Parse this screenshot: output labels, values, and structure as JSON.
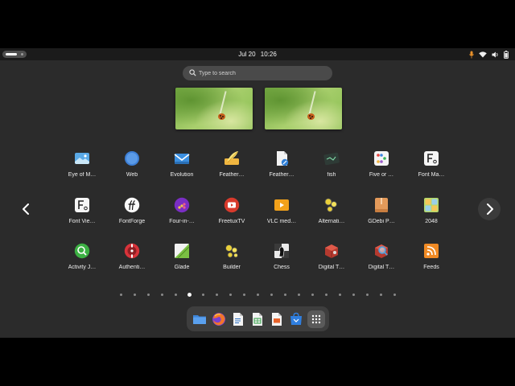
{
  "topbar": {
    "date": "Jul 20",
    "time": "10:26",
    "tray_icons": [
      "microphone-icon",
      "wifi-icon",
      "volume-icon",
      "battery-icon"
    ],
    "mic_color": "#e8902a"
  },
  "search": {
    "placeholder": "Type to search"
  },
  "workspaces": [
    {
      "name": "workspace-1"
    },
    {
      "name": "workspace-2"
    }
  ],
  "apps": [
    {
      "label": "Eye of M…",
      "icon": "eye-of-gnome-icon"
    },
    {
      "label": "Web",
      "icon": "web-browser-icon"
    },
    {
      "label": "Evolution",
      "icon": "evolution-mail-icon"
    },
    {
      "label": "Feather…",
      "icon": "feather-icon"
    },
    {
      "label": "Feather…",
      "icon": "feather-document-icon"
    },
    {
      "label": "fish",
      "icon": "fish-terminal-icon"
    },
    {
      "label": "Five or …",
      "icon": "five-or-more-icon"
    },
    {
      "label": "Font Ma…",
      "icon": "font-manager-icon"
    },
    {
      "label": "Font Vie…",
      "icon": "font-viewer-icon"
    },
    {
      "label": "FontForge",
      "icon": "fontforge-icon"
    },
    {
      "label": "Four-in-…",
      "icon": "four-in-a-row-icon"
    },
    {
      "label": "FreetuxTV",
      "icon": "freetuxtv-icon"
    },
    {
      "label": "VLC med…",
      "icon": "vlc-icon"
    },
    {
      "label": "Alternati…",
      "icon": "alternatives-icon"
    },
    {
      "label": "GDebi P…",
      "icon": "gdebi-icon"
    },
    {
      "label": "2048",
      "icon": "game-2048-icon"
    },
    {
      "label": "Activity J…",
      "icon": "activity-journal-icon"
    },
    {
      "label": "Authenti…",
      "icon": "authenticator-icon"
    },
    {
      "label": "Glade",
      "icon": "glade-icon"
    },
    {
      "label": "Builder",
      "icon": "builder-icon"
    },
    {
      "label": "Chess",
      "icon": "chess-icon"
    },
    {
      "label": "Digital T…",
      "icon": "digital-tv-icon"
    },
    {
      "label": "Digital T…",
      "icon": "digital-tv-search-icon"
    },
    {
      "label": "Feeds",
      "icon": "feeds-icon"
    }
  ],
  "pagination": {
    "total_pages": 21,
    "current_page": 5
  },
  "dash": [
    {
      "name": "files",
      "icon": "files-icon"
    },
    {
      "name": "firefox",
      "icon": "firefox-icon"
    },
    {
      "name": "writer",
      "icon": "libreoffice-writer-icon"
    },
    {
      "name": "calc",
      "icon": "libreoffice-calc-icon"
    },
    {
      "name": "impress",
      "icon": "libreoffice-impress-icon"
    },
    {
      "name": "software",
      "icon": "software-center-icon"
    },
    {
      "name": "show-apps",
      "icon": "app-grid-icon"
    }
  ]
}
